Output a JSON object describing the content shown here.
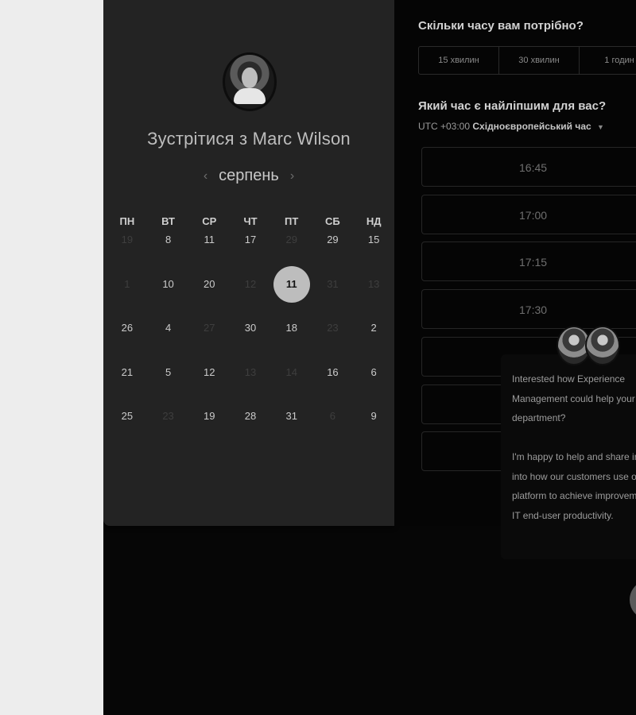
{
  "calendar": {
    "title": "Зустрітися з Marc Wilson",
    "month": "серпень",
    "prev_icon": "‹",
    "next_icon": "›",
    "weekdays": [
      "ПН",
      "ВТ",
      "СР",
      "ЧТ",
      "ПТ",
      "СБ",
      "НД"
    ],
    "weeks": [
      [
        {
          "d": "19",
          "a": false
        },
        {
          "d": "8",
          "a": true
        },
        {
          "d": "11",
          "a": true
        },
        {
          "d": "17",
          "a": true
        },
        {
          "d": "29",
          "a": false
        },
        {
          "d": "29",
          "a": true
        },
        {
          "d": "15",
          "a": true
        }
      ],
      [
        {
          "d": "1",
          "a": false
        },
        {
          "d": "10",
          "a": true
        },
        {
          "d": "20",
          "a": true
        },
        {
          "d": "12",
          "a": false
        },
        {
          "d": "11",
          "a": true,
          "selected": true
        },
        {
          "d": "31",
          "a": false
        },
        {
          "d": "13",
          "a": false
        }
      ],
      [
        {
          "d": "26",
          "a": true
        },
        {
          "d": "4",
          "a": true
        },
        {
          "d": "27",
          "a": false
        },
        {
          "d": "30",
          "a": true
        },
        {
          "d": "18",
          "a": true
        },
        {
          "d": "23",
          "a": false
        },
        {
          "d": "2",
          "a": true
        }
      ],
      [
        {
          "d": "21",
          "a": true
        },
        {
          "d": "5",
          "a": true
        },
        {
          "d": "12",
          "a": true
        },
        {
          "d": "13",
          "a": false
        },
        {
          "d": "14",
          "a": false
        },
        {
          "d": "16",
          "a": true
        },
        {
          "d": "6",
          "a": true
        }
      ],
      [
        {
          "d": "25",
          "a": true
        },
        {
          "d": "23",
          "a": false
        },
        {
          "d": "19",
          "a": true
        },
        {
          "d": "28",
          "a": true
        },
        {
          "d": "31",
          "a": true
        },
        {
          "d": "6",
          "a": false
        },
        {
          "d": "9",
          "a": true
        }
      ]
    ]
  },
  "booking": {
    "duration_question": "Скільки часу вам потрібно?",
    "durations": [
      "15 хвилин",
      "30 хвилин",
      "1 годин"
    ],
    "time_question": "Який час є найліпшим для вас?",
    "timezone_offset": "UTC +03:00",
    "timezone_name": "Східноєвропейський час",
    "slots": [
      "16:45",
      "17:00",
      "17:15",
      "17:30",
      "",
      "",
      ""
    ]
  },
  "chat": {
    "paragraph1": "Interested how Experience Management could help your department?",
    "paragraph2": "I'm happy to help and share insight into how our customers use our platform to achieve improvement in IT end-user productivity."
  }
}
